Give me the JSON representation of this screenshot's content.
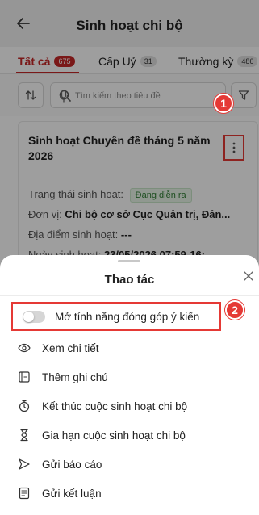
{
  "header": {
    "title": "Sinh hoạt chi bộ",
    "back_icon": "arrow-left-icon"
  },
  "tabs": [
    {
      "label": "Tất cả",
      "count": "675",
      "active": true
    },
    {
      "label": "Cấp Uỷ",
      "count": "31",
      "active": false
    },
    {
      "label": "Thường kỳ",
      "count": "486",
      "active": false
    }
  ],
  "search": {
    "placeholder": "Tìm kiếm theo tiêu đề"
  },
  "markers": {
    "one": "1",
    "two": "2"
  },
  "card": {
    "title": "Sinh hoạt Chuyên đề tháng 5 năm 2026",
    "status_label": "Trạng thái sinh hoạt:",
    "status_value": "Đang diễn ra",
    "unit_label": "Đơn vị:",
    "unit_value": "Chi bộ cơ sở Cục Quản trị, Đản...",
    "location_label": "Địa điểm sinh hoạt:",
    "location_value": "---",
    "date_label": "Ngày sinh hoạt:",
    "date_value": "23/05/2026 07:59-16:..."
  },
  "sheet": {
    "title": "Thao tác",
    "toggle_label": "Mở tính năng đóng góp ý kiến",
    "toggle_on": false,
    "actions": [
      {
        "label": "Xem chi tiết",
        "icon": "eye-icon"
      },
      {
        "label": "Thêm ghi chú",
        "icon": "note-icon"
      },
      {
        "label": "Kết thúc cuộc sinh hoạt chi bộ",
        "icon": "timer-icon"
      },
      {
        "label": "Gia hạn cuộc sinh hoạt chi bộ",
        "icon": "hourglass-icon"
      },
      {
        "label": "Gửi báo cáo",
        "icon": "send-icon"
      },
      {
        "label": "Gửi kết luận",
        "icon": "document-icon"
      }
    ]
  },
  "colors": {
    "accent": "#c62828",
    "marker": "#e53935",
    "status_green": "#2e7d32"
  }
}
